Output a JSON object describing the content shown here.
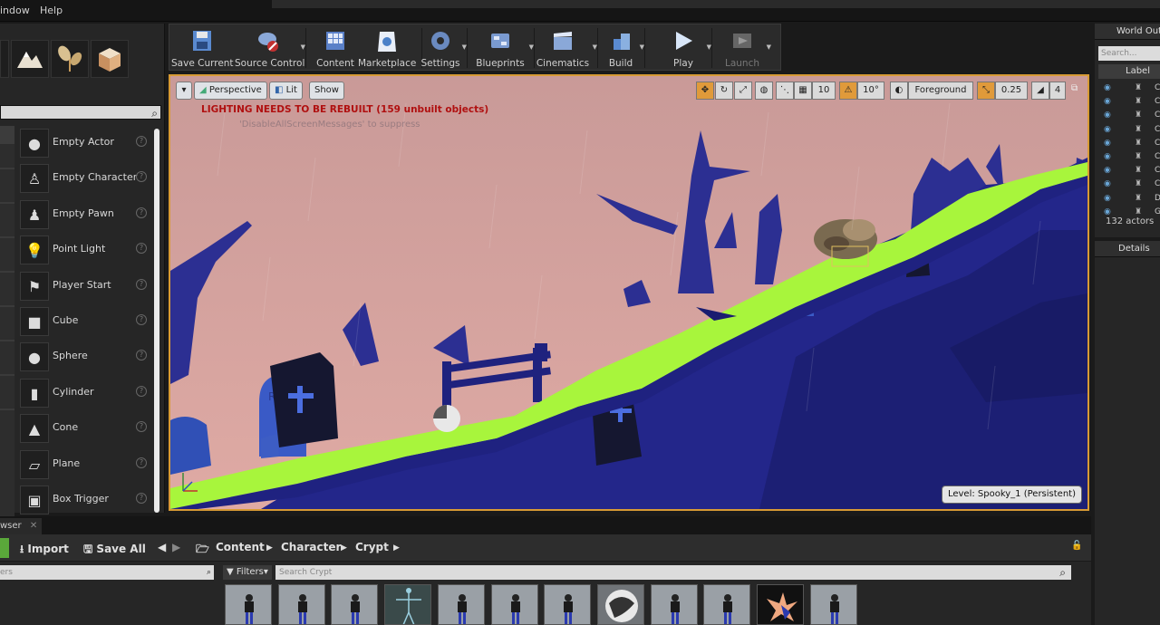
{
  "menubar": {
    "items": [
      "indow",
      "Help"
    ]
  },
  "modes": {
    "items": [
      {
        "label": "Empty Actor",
        "icon": "sphere-icon"
      },
      {
        "label": "Empty Character",
        "icon": "character-icon"
      },
      {
        "label": "Empty Pawn",
        "icon": "pawn-icon"
      },
      {
        "label": "Point Light",
        "icon": "lightbulb-icon"
      },
      {
        "label": "Player Start",
        "icon": "player-start-icon"
      },
      {
        "label": "Cube",
        "icon": "cube-icon"
      },
      {
        "label": "Sphere",
        "icon": "sphere-icon"
      },
      {
        "label": "Cylinder",
        "icon": "cylinder-icon"
      },
      {
        "label": "Cone",
        "icon": "cone-icon"
      },
      {
        "label": "Plane",
        "icon": "plane-icon"
      },
      {
        "label": "Box Trigger",
        "icon": "box-trigger-icon"
      }
    ]
  },
  "toolbar": {
    "buttons": [
      {
        "label": "Save Current",
        "icon": "save-icon"
      },
      {
        "label": "Source Control",
        "icon": "source-control-icon"
      },
      {
        "label": "Content",
        "icon": "content-icon"
      },
      {
        "label": "Marketplace",
        "icon": "marketplace-icon"
      },
      {
        "label": "Settings",
        "icon": "settings-icon"
      },
      {
        "label": "Blueprints",
        "icon": "blueprints-icon"
      },
      {
        "label": "Cinematics",
        "icon": "cinematics-icon"
      },
      {
        "label": "Build",
        "icon": "build-icon"
      },
      {
        "label": "Play",
        "icon": "play-icon"
      },
      {
        "label": "Launch",
        "icon": "launch-icon"
      }
    ]
  },
  "viewport": {
    "perspective": "Perspective",
    "lit": "Lit",
    "show": "Show",
    "warning": "LIGHTING NEEDS TO BE REBUILT (159 unbuilt objects)",
    "suppress": "'DisableAllScreenMessages' to suppress",
    "grid_snap": "10",
    "rot_snap": "10°",
    "layer": "Foreground",
    "scale_snap": "0.25",
    "cam_speed": "4",
    "level": "Level:  Spooky_1 (Persistent)"
  },
  "outliner": {
    "title": "World Outl",
    "search_placeholder": "Search...",
    "label_header": "Label",
    "rows": [
      "Co",
      "Co",
      "Co",
      "Co",
      "Cu",
      "Cu",
      "Cu",
      "Cu",
      "Di",
      "Gr"
    ],
    "count": "132 actors"
  },
  "details": {
    "title": "Details"
  },
  "content_browser": {
    "tab": "wser",
    "import": "Import",
    "save_all": "Save All",
    "path": [
      "Content",
      "Character",
      "Crypt"
    ],
    "left_search": "ers",
    "filters": "Filters",
    "search_placeholder": "Search Crypt"
  },
  "colors": {
    "accent": "#d79a34",
    "path_green": "#a8f53c",
    "terrain_blue": "#2a2d9a",
    "sky": "#d7a3a0",
    "warning_red": "#b01010"
  }
}
